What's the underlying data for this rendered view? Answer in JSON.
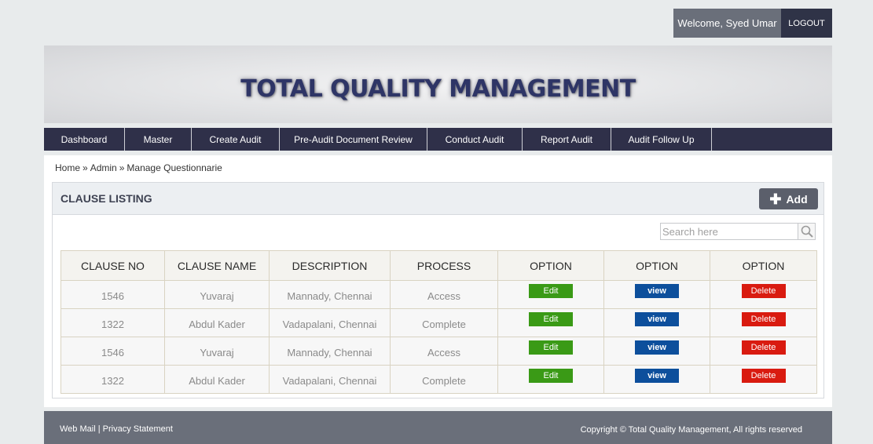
{
  "header": {
    "welcome": "Welcome, Syed Umar",
    "logout": "LOGOUT"
  },
  "banner": {
    "title": "TOTAL QUALITY MANAGEMENT"
  },
  "nav": [
    {
      "label": "Dashboard"
    },
    {
      "label": "Master"
    },
    {
      "label": "Create Audit"
    },
    {
      "label": "Pre-Audit Document Review"
    },
    {
      "label": "Conduct Audit"
    },
    {
      "label": "Report Audit"
    },
    {
      "label": "Audit Follow Up"
    }
  ],
  "breadcrumb": [
    "Home",
    "Admin",
    "Manage Questionnarie"
  ],
  "breadcrumb_sep": "»",
  "panel": {
    "title": "CLAUSE LISTING",
    "add_label": "Add",
    "search_placeholder": "Search here"
  },
  "table": {
    "headers": [
      "CLAUSE NO",
      "CLAUSE NAME",
      "DESCRIPTION",
      "PROCESS",
      "OPTION",
      "OPTION",
      "OPTION"
    ],
    "rows": [
      {
        "no": "1546",
        "name": "Yuvaraj",
        "desc": "Mannady, Chennai",
        "process": "Access",
        "edit": "Edit",
        "view": "view",
        "delete": "Delete"
      },
      {
        "no": "1322",
        "name": "Abdul Kader",
        "desc": "Vadapalani, Chennai",
        "process": "Complete",
        "edit": "Edit",
        "view": "view",
        "delete": "Delete"
      },
      {
        "no": "1546",
        "name": "Yuvaraj",
        "desc": "Mannady, Chennai",
        "process": "Access",
        "edit": "Edit",
        "view": "view",
        "delete": "Delete"
      },
      {
        "no": "1322",
        "name": "Abdul Kader",
        "desc": "Vadapalani, Chennai",
        "process": "Complete",
        "edit": "Edit",
        "view": "view",
        "delete": "Delete"
      }
    ]
  },
  "footer": {
    "webmail": "Web Mail",
    "divider": "|",
    "privacy": "Privacy Statement",
    "copyright": "Copyright © Total Quality Management, All rights reserved"
  },
  "colors": {
    "nav_bg": "#2f3049",
    "title": "#2e3566",
    "edit": "#3a9a16",
    "view": "#0d4f9c",
    "delete": "#d91b10",
    "footer_bg": "#6a6f7a"
  },
  "icons": {
    "search": "search-icon",
    "add": "plus-icon"
  }
}
